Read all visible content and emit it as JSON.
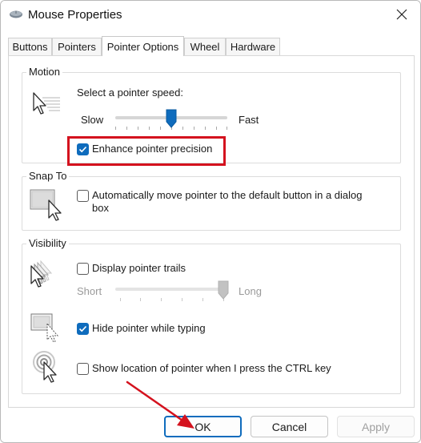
{
  "window": {
    "title": "Mouse Properties",
    "icon": "mouse-icon",
    "close_icon": "close-icon"
  },
  "tabs": [
    {
      "label": "Buttons",
      "active": false
    },
    {
      "label": "Pointers",
      "active": false
    },
    {
      "label": "Pointer Options",
      "active": true
    },
    {
      "label": "Wheel",
      "active": false
    },
    {
      "label": "Hardware",
      "active": false
    }
  ],
  "motion": {
    "group_label": "Motion",
    "icon": "pointer-speed-icon",
    "speed_label": "Select a pointer speed:",
    "slow_label": "Slow",
    "fast_label": "Fast",
    "speed_value": 0.5,
    "enhance_precision": {
      "label": "Enhance pointer precision",
      "checked": true
    }
  },
  "snap_to": {
    "group_label": "Snap To",
    "icon": "snap-to-button-icon",
    "option": {
      "label_line1": "Automatically move pointer to the default button in a dialog",
      "label_line2": "box",
      "checked": false
    }
  },
  "visibility": {
    "group_label": "Visibility",
    "trails_icon": "pointer-trails-icon",
    "trails": {
      "label": "Display pointer trails",
      "checked": false
    },
    "short_label": "Short",
    "long_label": "Long",
    "trail_length": 1.0,
    "hide_icon": "hide-pointer-icon",
    "hide_while_typing": {
      "label": "Hide pointer while typing",
      "checked": true
    },
    "location_icon": "pointer-location-icon",
    "show_location": {
      "label": "Show location of pointer when I press the CTRL key",
      "checked": false
    }
  },
  "buttons": {
    "ok": "OK",
    "cancel": "Cancel",
    "apply": "Apply"
  },
  "annotation": {
    "highlight_color": "#d4121e",
    "arrow_color": "#d4121e"
  }
}
